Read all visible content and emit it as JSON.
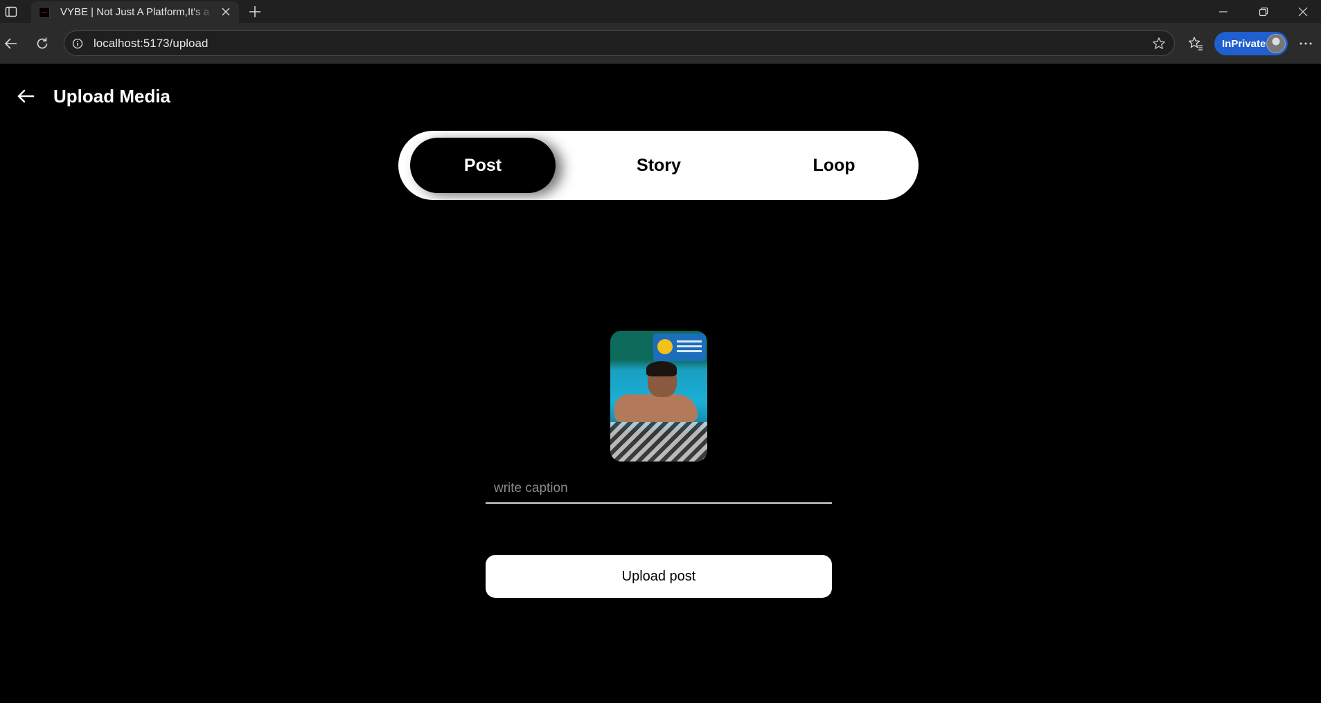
{
  "browser": {
    "tab_title": "VYBE | Not Just A Platform,It's a Vybe",
    "url": "localhost:5173/upload",
    "inprivate_label": "InPrivate"
  },
  "page": {
    "title": "Upload Media",
    "tabs": [
      {
        "label": "Post",
        "active": true
      },
      {
        "label": "Story",
        "active": false
      },
      {
        "label": "Loop",
        "active": false
      }
    ],
    "caption": {
      "placeholder": "write caption",
      "value": ""
    },
    "upload_button_label": "Upload post"
  },
  "colors": {
    "page_background": "#000000",
    "toggle_background": "#ffffff",
    "active_tab": "#000000",
    "inprivate_badge": "#1f5fcf"
  },
  "icons": {
    "back": "arrow-left-icon",
    "tab_close": "close-icon",
    "new_tab": "plus-icon",
    "reload": "reload-icon",
    "favorite": "star-icon",
    "favorites": "favorites-icon",
    "more": "more-icon"
  }
}
